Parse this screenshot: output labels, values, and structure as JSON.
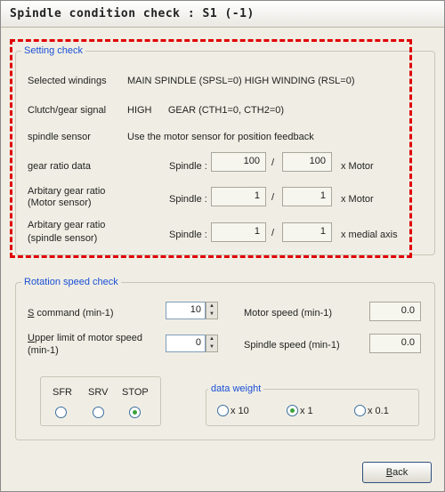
{
  "title": "Spindle condition check : S1 (-1)",
  "setting_check": {
    "legend": "Setting check",
    "selected_windings_label": "Selected windings",
    "selected_windings_value": "MAIN SPINDLE (SPSL=0) HIGH WINDING (RSL=0)",
    "clutch_label": "Clutch/gear signal",
    "clutch_value": "HIGH      GEAR (CTH1=0, CTH2=0)",
    "sensor_label": "spindle sensor",
    "sensor_value": "Use the motor sensor for position feedback",
    "gear_ratio_label": "gear ratio data",
    "gear_ratio": {
      "spindle_label": "Spindle :",
      "a": "100",
      "slash": "/",
      "b": "100",
      "unit": "x Motor"
    },
    "arb_motor_label_1": "Arbitary gear ratio",
    "arb_motor_label_2": "(Motor sensor)",
    "arb_motor": {
      "spindle_label": "Spindle :",
      "a": "1",
      "slash": "/",
      "b": "1",
      "unit": "x Motor"
    },
    "arb_spindle_label_1": "Arbitary gear ratio",
    "arb_spindle_label_2": "(spindle sensor)",
    "arb_spindle": {
      "spindle_label": "Spindle :",
      "a": "1",
      "slash": "/",
      "b": "1",
      "unit": "x medial axis"
    }
  },
  "rotation_check": {
    "legend": "Rotation speed check",
    "s_command_label_u": "S",
    "s_command_label_rest": " command (min-1)",
    "s_command_value": "10",
    "upper_limit_label_u": "U",
    "upper_limit_label_rest_1": "pper limit of motor speed",
    "upper_limit_label_2": "(min-1)",
    "upper_limit_value": "0",
    "motor_speed_label": "Motor speed (min-1)",
    "motor_speed_value": "0.0",
    "spindle_speed_label": "Spindle speed (min-1)",
    "spindle_speed_value": "0.0",
    "direction": {
      "sfr": "SFR",
      "srv": "SRV",
      "stop": "STOP",
      "selected": "STOP"
    },
    "data_weight": {
      "legend": "data weight",
      "x10": "x 10",
      "x1": "x 1",
      "x01": "x 0.1",
      "selected": "x 1"
    }
  },
  "back_u": "B",
  "back_rest": "ack"
}
